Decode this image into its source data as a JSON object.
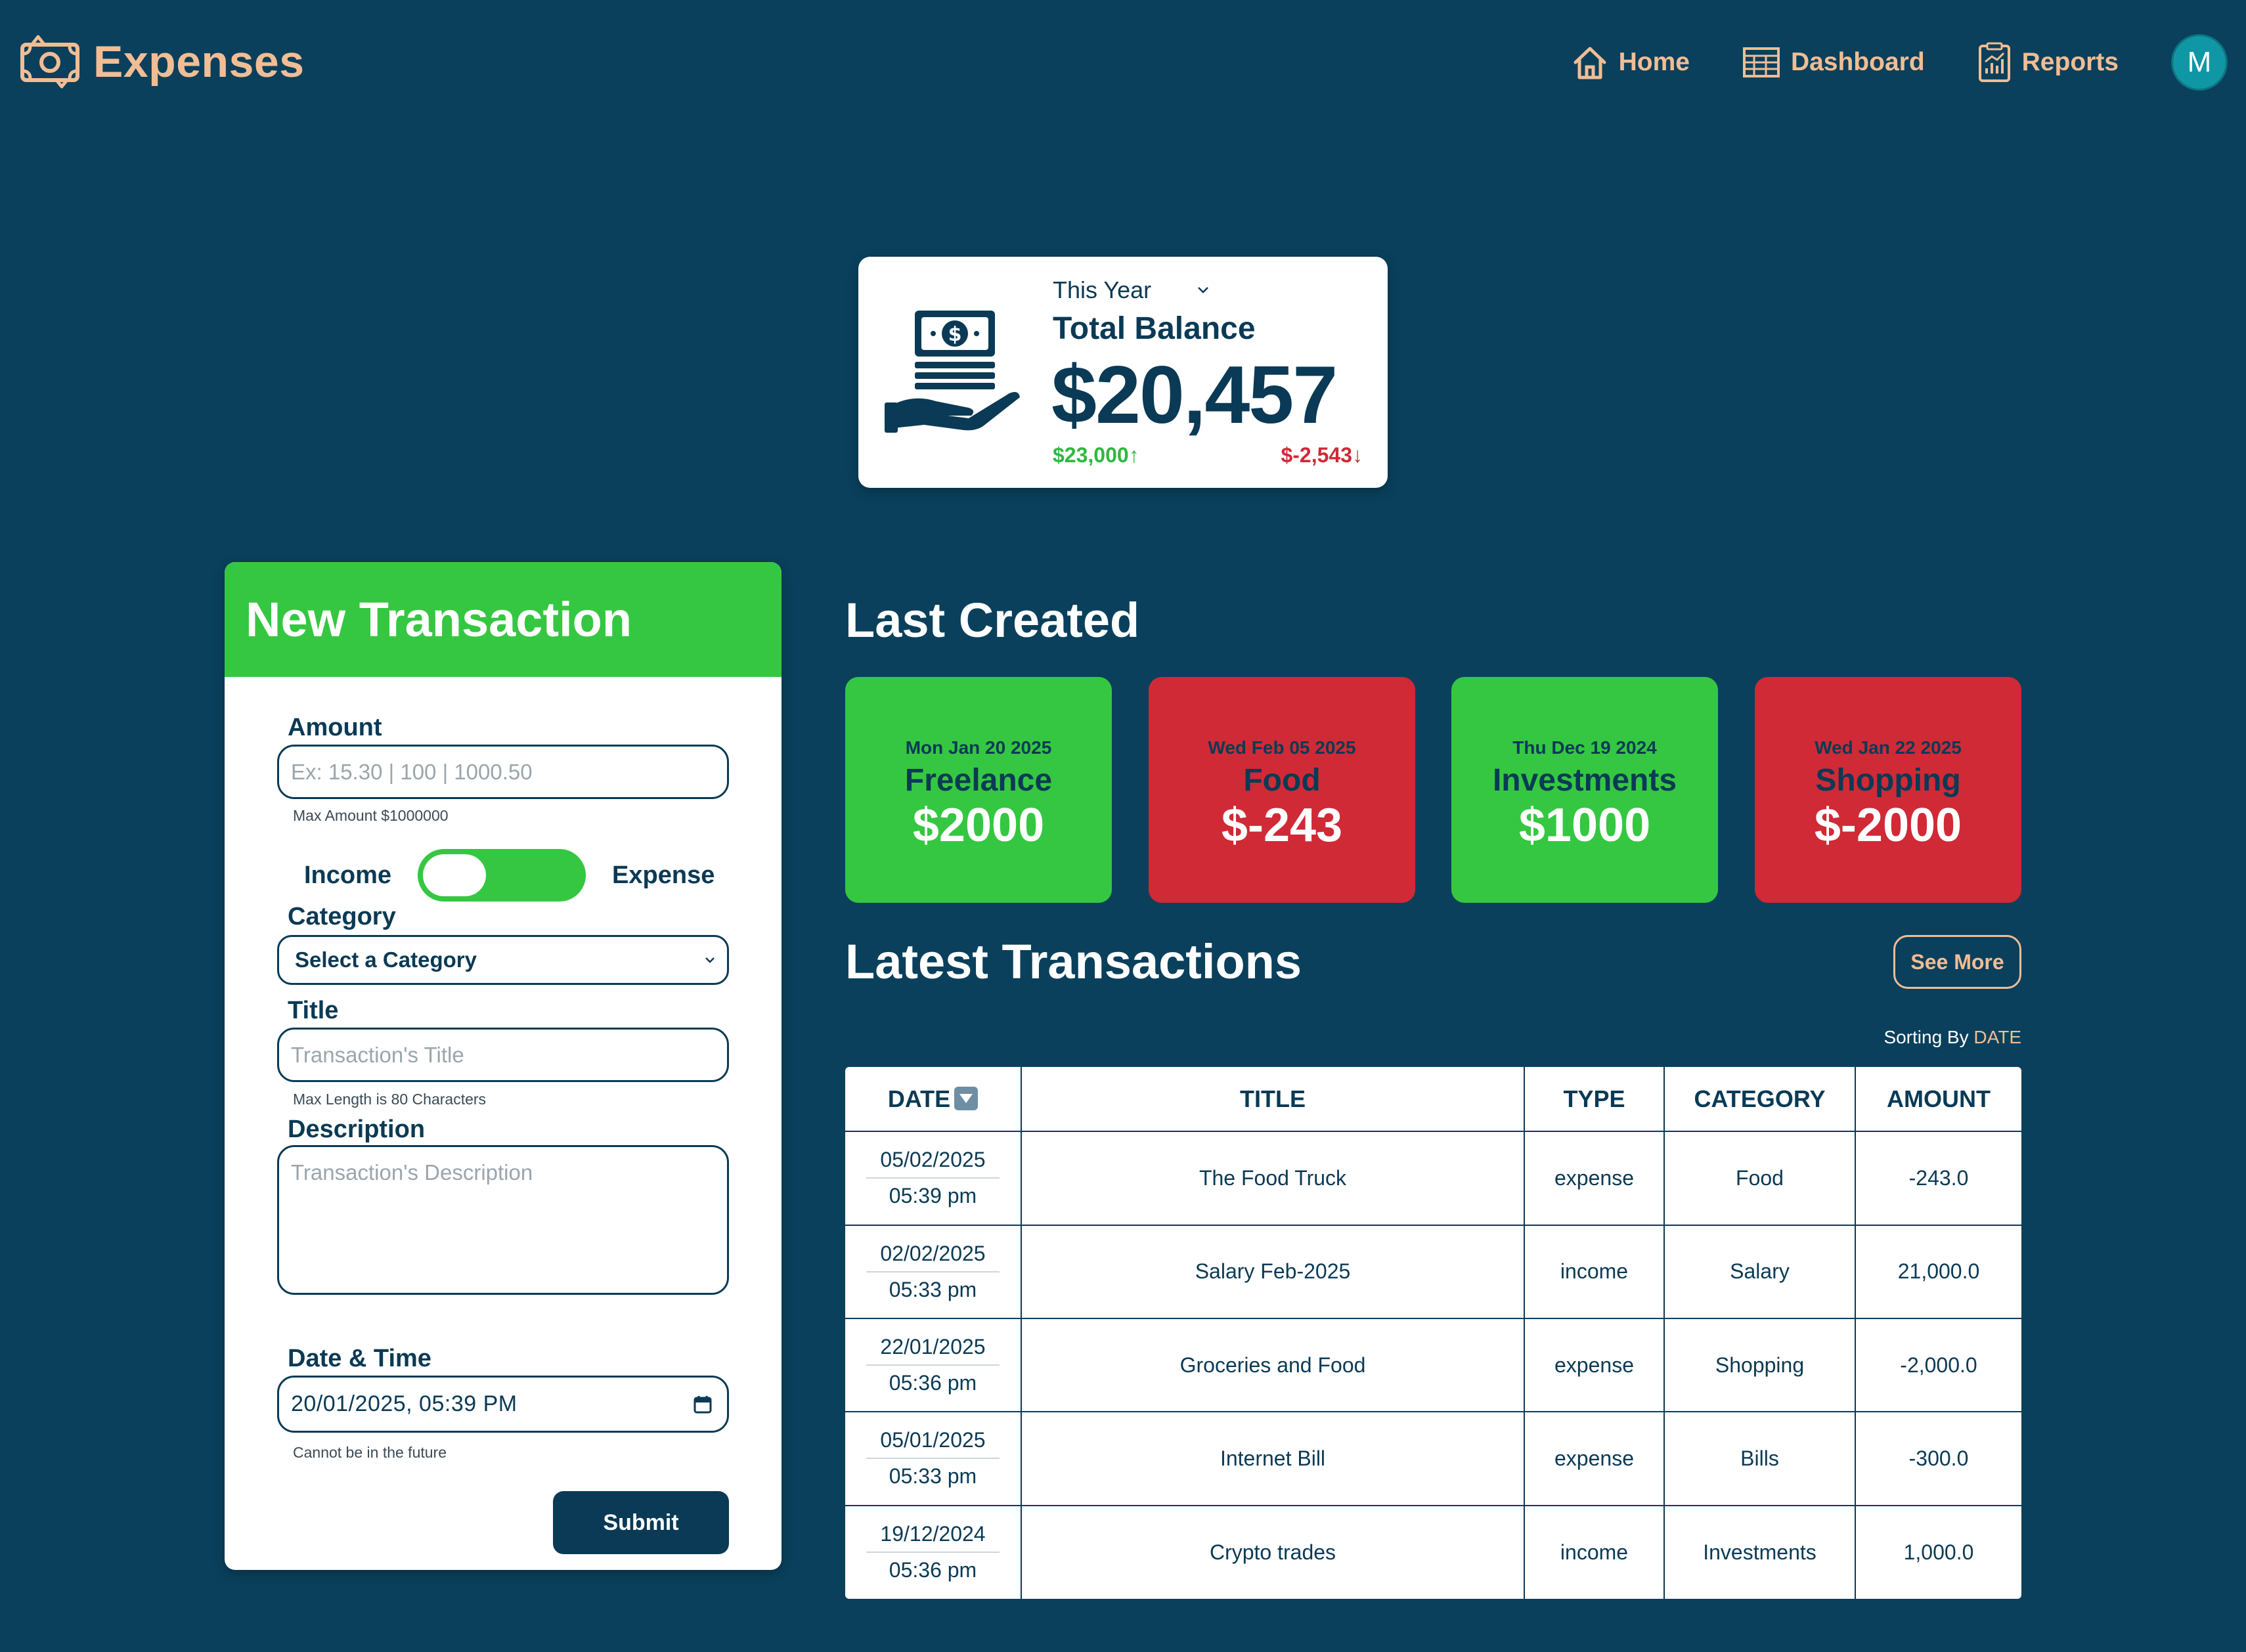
{
  "app": {
    "brand": "Expenses",
    "avatar_initial": "M"
  },
  "nav": {
    "home": "Home",
    "dashboard": "Dashboard",
    "reports": "Reports"
  },
  "balance": {
    "period": "This Year",
    "label": "Total Balance",
    "value": "$20,457",
    "income": "$23,000↑",
    "expense": "$-2,543↓"
  },
  "form": {
    "title": "New Transaction",
    "amount_label": "Amount",
    "amount_placeholder": "Ex: 15.30 | 100 | 1000.50",
    "amount_hint": "Max Amount $1000000",
    "toggle_left": "Income",
    "toggle_right": "Expense",
    "category_label": "Category",
    "category_value": "Select a Category",
    "title_label": "Title",
    "title_placeholder": "Transaction's Title",
    "title_hint": "Max Length is 80 Characters",
    "description_label": "Description",
    "description_placeholder": "Transaction's Description",
    "datetime_label": "Date & Time",
    "datetime_value": "20/01/2025, 05:39 PM",
    "datetime_hint": "Cannot be in the future",
    "submit": "Submit"
  },
  "last_created": {
    "title": "Last Created",
    "cards": [
      {
        "date": "Mon Jan 20 2025",
        "category": "Freelance",
        "amount": "$2000"
      },
      {
        "date": "Wed Feb 05 2025",
        "category": "Food",
        "amount": "$-243"
      },
      {
        "date": "Thu Dec 19 2024",
        "category": "Investments",
        "amount": "$1000"
      },
      {
        "date": "Wed Jan 22 2025",
        "category": "Shopping",
        "amount": "$-2000"
      }
    ]
  },
  "latest": {
    "title": "Latest Transactions",
    "see_more": "See More",
    "sorting_label": "Sorting By ",
    "sorting_value": "DATE",
    "headers": [
      "DATE",
      "TITLE",
      "TYPE",
      "CATEGORY",
      "AMOUNT"
    ],
    "rows": [
      {
        "date": "05/02/2025",
        "time": "05:39 pm",
        "title": "The Food Truck",
        "type": "expense",
        "category": "Food",
        "amount": "-243.0"
      },
      {
        "date": "02/02/2025",
        "time": "05:33 pm",
        "title": "Salary Feb-2025",
        "type": "income",
        "category": "Salary",
        "amount": "21,000.0"
      },
      {
        "date": "22/01/2025",
        "time": "05:36 pm",
        "title": "Groceries and Food",
        "type": "expense",
        "category": "Shopping",
        "amount": "-2,000.0"
      },
      {
        "date": "05/01/2025",
        "time": "05:33 pm",
        "title": "Internet Bill",
        "type": "expense",
        "category": "Bills",
        "amount": "-300.0"
      },
      {
        "date": "19/12/2024",
        "time": "05:36 pm",
        "title": "Crypto trades",
        "type": "income",
        "category": "Investments",
        "amount": "1,000.0"
      }
    ]
  },
  "colors": {
    "background": "#0a405c",
    "accent": "#f2bd94",
    "income": "#35c741",
    "expense": "#cf2a36",
    "text_dark": "#0a3a55"
  }
}
